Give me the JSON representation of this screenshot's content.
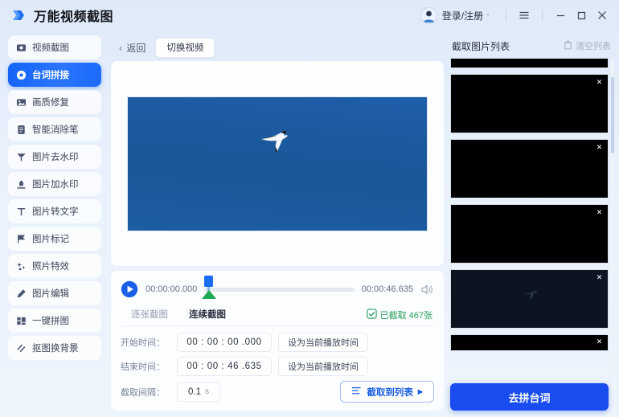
{
  "window": {
    "app_title": "万能视频截图",
    "logo_icon": "blue-arrow-logo",
    "account_label": "登录/注册",
    "account_caret": "⌄",
    "avatar_icon": "user-avatar",
    "menu_icon": "hamburger-menu-icon",
    "minimize_icon": "minimize-icon",
    "maximize_icon": "maximize-icon",
    "close_icon": "close-icon"
  },
  "sidebar": {
    "items": [
      {
        "label": "视频截图",
        "icon": "video-capture-icon",
        "active": false
      },
      {
        "label": "台词拼接",
        "icon": "subtitle-stitch-icon",
        "active": true
      },
      {
        "label": "画质修复",
        "icon": "image-restore-icon",
        "active": false
      },
      {
        "label": "智能消除笔",
        "icon": "smart-eraser-icon",
        "active": false
      },
      {
        "label": "图片去水印",
        "icon": "remove-watermark-icon",
        "active": false
      },
      {
        "label": "图片加水印",
        "icon": "add-watermark-icon",
        "active": false
      },
      {
        "label": "图片转文字",
        "icon": "image-to-text-icon",
        "active": false
      },
      {
        "label": "图片标记",
        "icon": "image-mark-icon",
        "active": false
      },
      {
        "label": "照片特效",
        "icon": "photo-effects-icon",
        "active": false
      },
      {
        "label": "图片编辑",
        "icon": "image-edit-icon",
        "active": false
      },
      {
        "label": "一键拼图",
        "icon": "collage-icon",
        "active": false
      },
      {
        "label": "抠图换背景",
        "icon": "background-remove-icon",
        "active": false
      }
    ]
  },
  "center": {
    "back_label": "返回",
    "back_icon": "chevron-left-icon",
    "switch_video_label": "切换视频",
    "preview": {
      "description": "flying-bird-blue-sky",
      "sky_color_top": "#1f5ea9",
      "sky_color_bottom": "#1d5da1"
    },
    "player": {
      "play_icon": "play-circle-icon",
      "current_time": "00:00:00.000",
      "total_time": "00:00:46.635",
      "volume_icon": "volume-icon",
      "start_marker_color": "#1a6cf0",
      "end_marker_color": "#1ea84f",
      "progress_percent": 0
    },
    "tabs": [
      {
        "label": "逐张截图",
        "active": false
      },
      {
        "label": "连续截图",
        "active": true
      }
    ],
    "captured": {
      "icon": "checkbox-check-icon",
      "label": "已截取 467张",
      "color": "#27a05a"
    },
    "form": {
      "start_label": "开始时间：",
      "start_value": "00 : 00 : 00 .000",
      "start_button": "设为当前播放时间",
      "end_label": "结束时间：",
      "end_value": "00 : 00 : 46 .635",
      "end_button": "设为当前播放时间",
      "interval_label": "截取间隔：",
      "interval_value": "0.1",
      "interval_unit": "s",
      "capture_button": "截取到列表",
      "capture_icon": "list-lines-icon",
      "capture_arrow": "▶"
    }
  },
  "right_panel": {
    "title": "截取图片列表",
    "clear_label": "清空列表",
    "clear_icon": "trash-icon",
    "thumbnails": [
      {
        "name": "thumb-partial-top",
        "kind": "clip-top",
        "close_icon": ""
      },
      {
        "name": "thumb-1",
        "kind": "black",
        "close_icon": "✕"
      },
      {
        "name": "thumb-2",
        "kind": "black",
        "close_icon": "✕"
      },
      {
        "name": "thumb-3",
        "kind": "black",
        "close_icon": "✕"
      },
      {
        "name": "thumb-4",
        "kind": "dark-bird",
        "close_icon": "✕"
      },
      {
        "name": "thumb-partial-bottom",
        "kind": "clip-bottom",
        "close_icon": "✕"
      }
    ],
    "primary_button": "去拼台词",
    "primary_color": "#1a4df0"
  }
}
